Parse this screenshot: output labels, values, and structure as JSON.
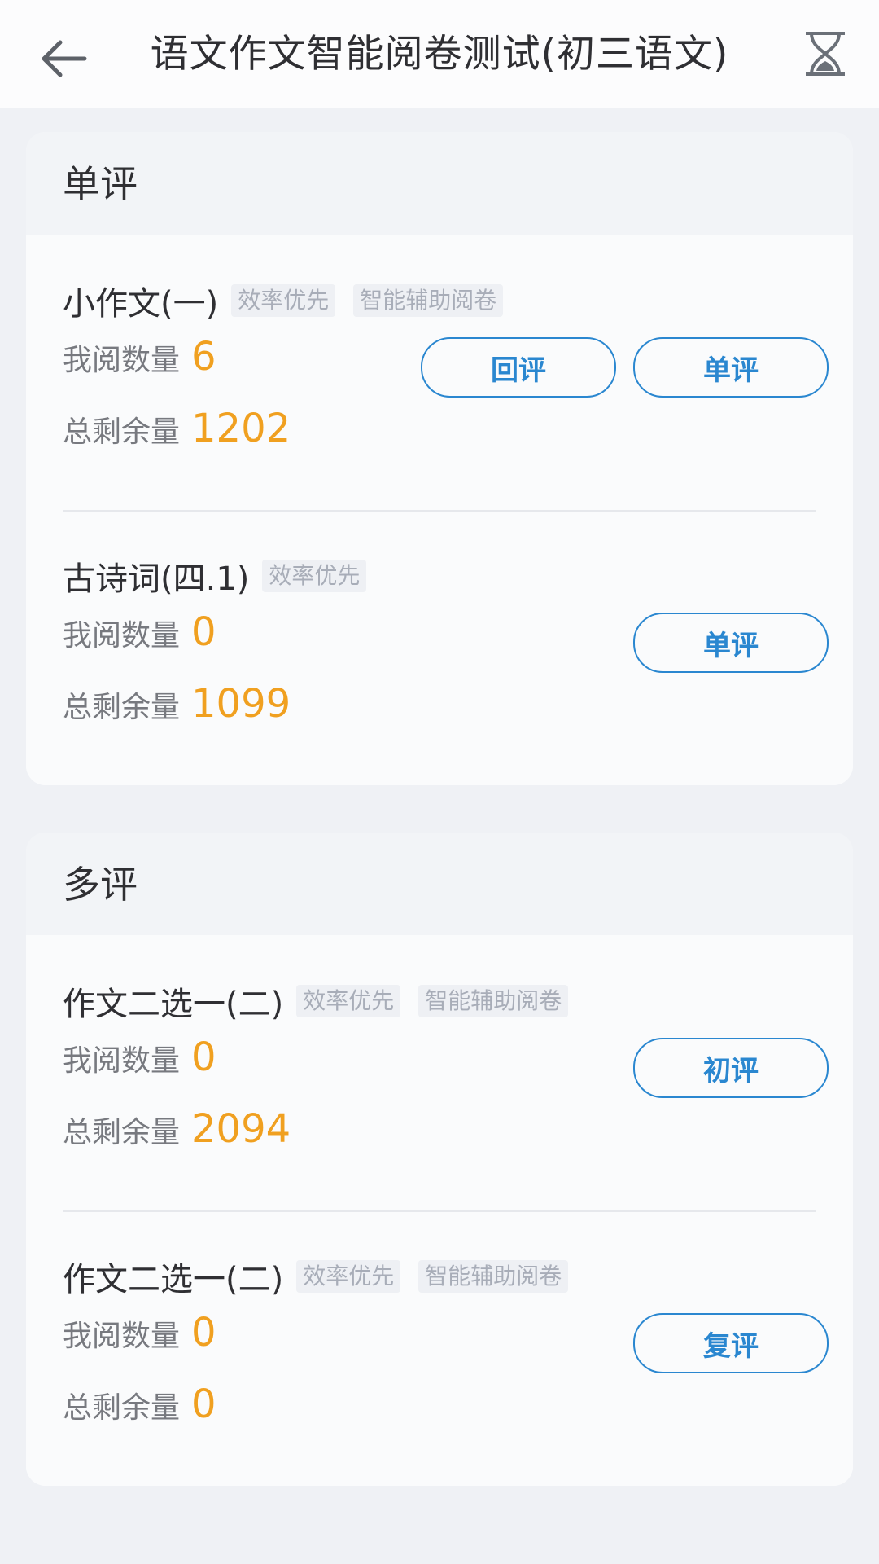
{
  "header": {
    "title": "语文作文智能阅卷测试(初三语文)",
    "back_icon": "arrow-left-icon",
    "timer_icon": "hourglass-icon"
  },
  "colors": {
    "accent": "#2a87d0",
    "number": "#f0a020",
    "tag_text": "#a8adb8",
    "background": "#eff1f5"
  },
  "sections": [
    {
      "title": "单评",
      "items": [
        {
          "title": "小作文(一)",
          "tags": [
            "效率优先",
            "智能辅助阅卷"
          ],
          "my_count_label": "我阅数量",
          "my_count": "6",
          "remaining_label": "总剩余量",
          "remaining": "1202",
          "buttons": [
            "回评",
            "单评"
          ]
        },
        {
          "title": "古诗词(四.1)",
          "tags": [
            "效率优先"
          ],
          "my_count_label": "我阅数量",
          "my_count": "0",
          "remaining_label": "总剩余量",
          "remaining": "1099",
          "buttons": [
            "单评"
          ]
        }
      ]
    },
    {
      "title": "多评",
      "items": [
        {
          "title": "作文二选一(二)",
          "tags": [
            "效率优先",
            "智能辅助阅卷"
          ],
          "my_count_label": "我阅数量",
          "my_count": "0",
          "remaining_label": "总剩余量",
          "remaining": "2094",
          "buttons": [
            "初评"
          ]
        },
        {
          "title": "作文二选一(二)",
          "tags": [
            "效率优先",
            "智能辅助阅卷"
          ],
          "my_count_label": "我阅数量",
          "my_count": "0",
          "remaining_label": "总剩余量",
          "remaining": "0",
          "buttons": [
            "复评"
          ]
        }
      ]
    }
  ]
}
